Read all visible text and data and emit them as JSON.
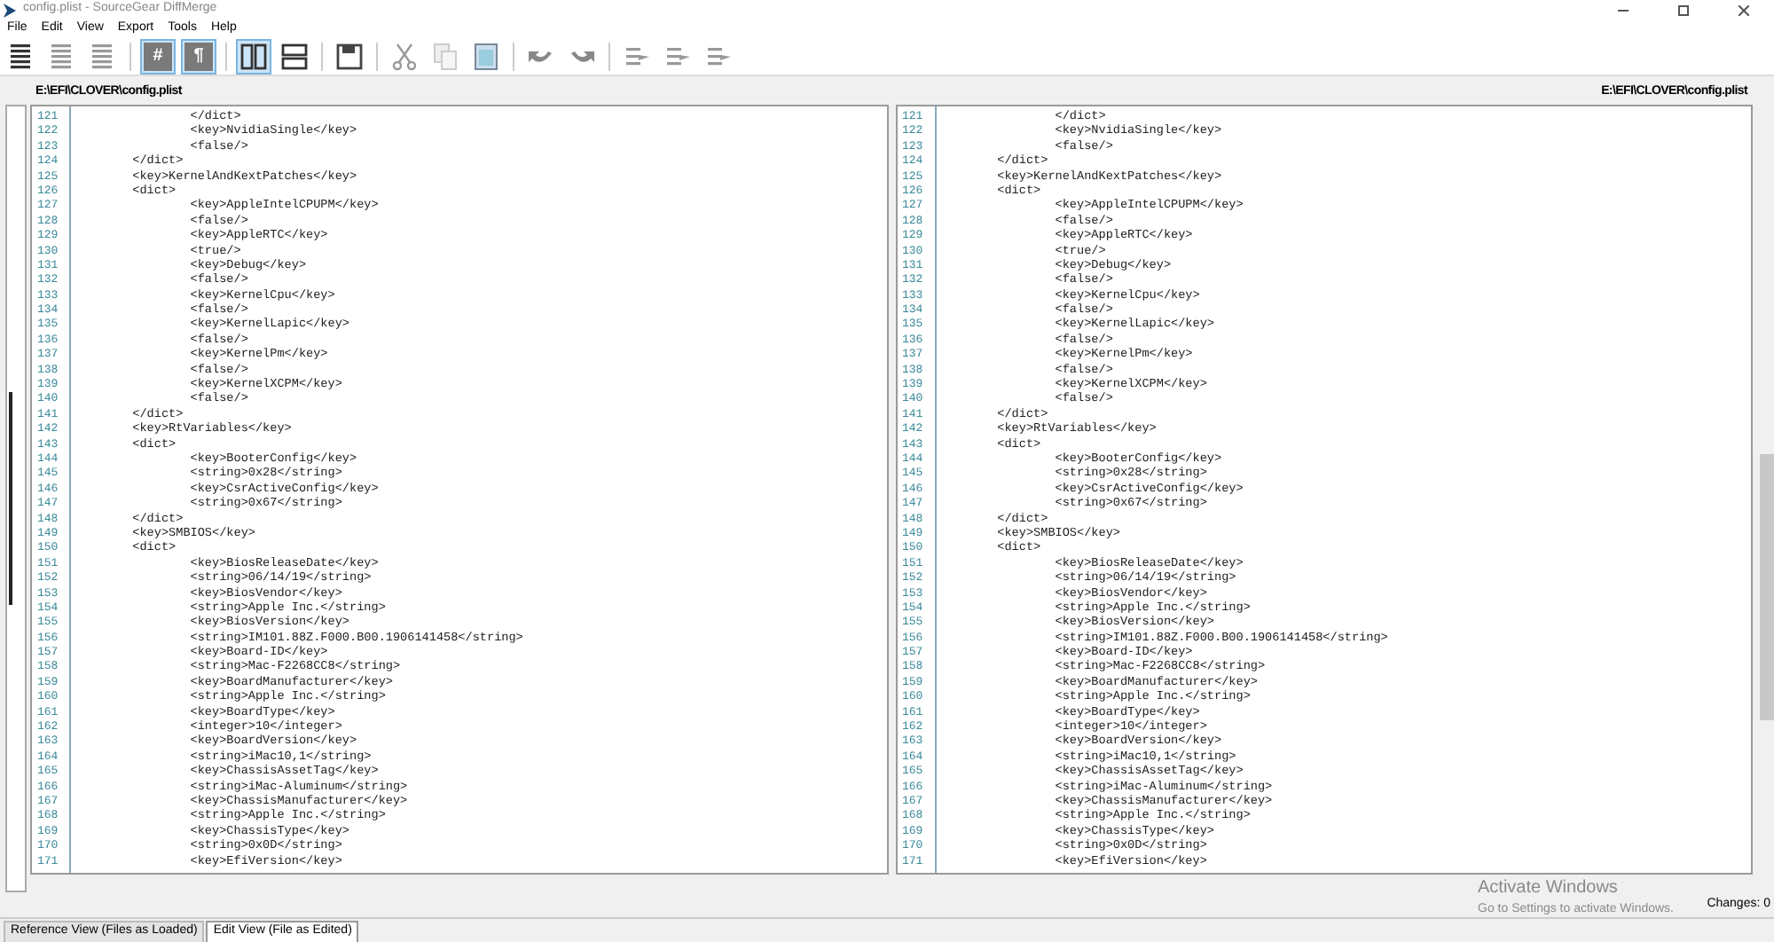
{
  "window": {
    "title": "config.plist - SourceGear DiffMerge"
  },
  "menu": [
    "File",
    "Edit",
    "View",
    "Export",
    "Tools",
    "Help"
  ],
  "toolbar": [
    {
      "kind": "lines-all",
      "selected": false
    },
    {
      "kind": "lines-diff",
      "selected": false
    },
    {
      "kind": "lines-ctx",
      "selected": false
    },
    {
      "kind": "sep"
    },
    {
      "kind": "char",
      "label": "#",
      "selected": true
    },
    {
      "kind": "char",
      "label": "¶",
      "selected": true
    },
    {
      "kind": "sep"
    },
    {
      "kind": "side-by-side",
      "selected": true
    },
    {
      "kind": "stacked",
      "selected": false
    },
    {
      "kind": "sep"
    },
    {
      "kind": "save",
      "selected": false
    },
    {
      "kind": "sep"
    },
    {
      "kind": "cut",
      "selected": false
    },
    {
      "kind": "copy",
      "selected": false
    },
    {
      "kind": "paste",
      "selected": false
    },
    {
      "kind": "sep"
    },
    {
      "kind": "undo",
      "selected": false
    },
    {
      "kind": "redo",
      "selected": false
    },
    {
      "kind": "sep"
    },
    {
      "kind": "merge-prev",
      "selected": false
    },
    {
      "kind": "merge-next",
      "selected": false
    },
    {
      "kind": "merge-all",
      "selected": false
    }
  ],
  "panes": [
    {
      "path": "E:\\EFI\\CLOVER\\config.plist",
      "lines": [
        {
          "number": "121",
          "text": "\t\t\t\t</dict>"
        },
        {
          "number": "122",
          "text": "\t\t\t\t<key>NvidiaSingle</key>"
        },
        {
          "number": "123",
          "text": "\t\t\t\t<false/>"
        },
        {
          "number": "124",
          "text": "\t\t</dict>"
        },
        {
          "number": "125",
          "text": "\t\t<key>KernelAndKextPatches</key>"
        },
        {
          "number": "126",
          "text": "\t\t<dict>"
        },
        {
          "number": "127",
          "text": "\t\t\t\t<key>AppleIntelCPUPM</key>"
        },
        {
          "number": "128",
          "text": "\t\t\t\t<false/>"
        },
        {
          "number": "129",
          "text": "\t\t\t\t<key>AppleRTC</key>"
        },
        {
          "number": "130",
          "text": "\t\t\t\t<true/>"
        },
        {
          "number": "131",
          "text": "\t\t\t\t<key>Debug</key>"
        },
        {
          "number": "132",
          "text": "\t\t\t\t<false/>"
        },
        {
          "number": "133",
          "text": "\t\t\t\t<key>KernelCpu</key>"
        },
        {
          "number": "134",
          "text": "\t\t\t\t<false/>"
        },
        {
          "number": "135",
          "text": "\t\t\t\t<key>KernelLapic</key>"
        },
        {
          "number": "136",
          "text": "\t\t\t\t<false/>"
        },
        {
          "number": "137",
          "text": "\t\t\t\t<key>KernelPm</key>"
        },
        {
          "number": "138",
          "text": "\t\t\t\t<false/>"
        },
        {
          "number": "139",
          "text": "\t\t\t\t<key>KernelXCPM</key>"
        },
        {
          "number": "140",
          "text": "\t\t\t\t<false/>"
        },
        {
          "number": "141",
          "text": "\t\t</dict>"
        },
        {
          "number": "142",
          "text": "\t\t<key>RtVariables</key>"
        },
        {
          "number": "143",
          "text": "\t\t<dict>"
        },
        {
          "number": "144",
          "text": "\t\t\t\t<key>BooterConfig</key>"
        },
        {
          "number": "145",
          "text": "\t\t\t\t<string>0x28</string>"
        },
        {
          "number": "146",
          "text": "\t\t\t\t<key>CsrActiveConfig</key>"
        },
        {
          "number": "147",
          "text": "\t\t\t\t<string>0x67</string>"
        },
        {
          "number": "148",
          "text": "\t\t</dict>"
        },
        {
          "number": "149",
          "text": "\t\t<key>SMBIOS</key>"
        },
        {
          "number": "150",
          "text": "\t\t<dict>"
        },
        {
          "number": "151",
          "text": "\t\t\t\t<key>BiosReleaseDate</key>"
        },
        {
          "number": "152",
          "text": "\t\t\t\t<string>06/14/19</string>"
        },
        {
          "number": "153",
          "text": "\t\t\t\t<key>BiosVendor</key>"
        },
        {
          "number": "154",
          "text": "\t\t\t\t<string>Apple Inc.</string>"
        },
        {
          "number": "155",
          "text": "\t\t\t\t<key>BiosVersion</key>"
        },
        {
          "number": "156",
          "text": "\t\t\t\t<string>IM101.88Z.F000.B00.1906141458</string>"
        },
        {
          "number": "157",
          "text": "\t\t\t\t<key>Board-ID</key>"
        },
        {
          "number": "158",
          "text": "\t\t\t\t<string>Mac-F2268CC8</string>"
        },
        {
          "number": "159",
          "text": "\t\t\t\t<key>BoardManufacturer</key>"
        },
        {
          "number": "160",
          "text": "\t\t\t\t<string>Apple Inc.</string>"
        },
        {
          "number": "161",
          "text": "\t\t\t\t<key>BoardType</key>"
        },
        {
          "number": "162",
          "text": "\t\t\t\t<integer>10</integer>"
        },
        {
          "number": "163",
          "text": "\t\t\t\t<key>BoardVersion</key>"
        },
        {
          "number": "164",
          "text": "\t\t\t\t<string>iMac10,1</string>"
        },
        {
          "number": "165",
          "text": "\t\t\t\t<key>ChassisAssetTag</key>"
        },
        {
          "number": "166",
          "text": "\t\t\t\t<string>iMac-Aluminum</string>"
        },
        {
          "number": "167",
          "text": "\t\t\t\t<key>ChassisManufacturer</key>"
        },
        {
          "number": "168",
          "text": "\t\t\t\t<string>Apple Inc.</string>"
        },
        {
          "number": "169",
          "text": "\t\t\t\t<key>ChassisType</key>"
        },
        {
          "number": "170",
          "text": "\t\t\t\t<string>0x0D</string>"
        },
        {
          "number": "171",
          "text": "\t\t\t\t<key>EfiVersion</key>"
        }
      ]
    },
    {
      "path": "E:\\EFI\\CLOVER\\config.plist",
      "lines": [
        {
          "number": "121",
          "text": "\t\t\t\t</dict>"
        },
        {
          "number": "122",
          "text": "\t\t\t\t<key>NvidiaSingle</key>"
        },
        {
          "number": "123",
          "text": "\t\t\t\t<false/>"
        },
        {
          "number": "124",
          "text": "\t\t</dict>"
        },
        {
          "number": "125",
          "text": "\t\t<key>KernelAndKextPatches</key>"
        },
        {
          "number": "126",
          "text": "\t\t<dict>"
        },
        {
          "number": "127",
          "text": "\t\t\t\t<key>AppleIntelCPUPM</key>"
        },
        {
          "number": "128",
          "text": "\t\t\t\t<false/>"
        },
        {
          "number": "129",
          "text": "\t\t\t\t<key>AppleRTC</key>"
        },
        {
          "number": "130",
          "text": "\t\t\t\t<true/>"
        },
        {
          "number": "131",
          "text": "\t\t\t\t<key>Debug</key>"
        },
        {
          "number": "132",
          "text": "\t\t\t\t<false/>"
        },
        {
          "number": "133",
          "text": "\t\t\t\t<key>KernelCpu</key>"
        },
        {
          "number": "134",
          "text": "\t\t\t\t<false/>"
        },
        {
          "number": "135",
          "text": "\t\t\t\t<key>KernelLapic</key>"
        },
        {
          "number": "136",
          "text": "\t\t\t\t<false/>"
        },
        {
          "number": "137",
          "text": "\t\t\t\t<key>KernelPm</key>"
        },
        {
          "number": "138",
          "text": "\t\t\t\t<false/>"
        },
        {
          "number": "139",
          "text": "\t\t\t\t<key>KernelXCPM</key>"
        },
        {
          "number": "140",
          "text": "\t\t\t\t<false/>"
        },
        {
          "number": "141",
          "text": "\t\t</dict>"
        },
        {
          "number": "142",
          "text": "\t\t<key>RtVariables</key>"
        },
        {
          "number": "143",
          "text": "\t\t<dict>"
        },
        {
          "number": "144",
          "text": "\t\t\t\t<key>BooterConfig</key>"
        },
        {
          "number": "145",
          "text": "\t\t\t\t<string>0x28</string>"
        },
        {
          "number": "146",
          "text": "\t\t\t\t<key>CsrActiveConfig</key>"
        },
        {
          "number": "147",
          "text": "\t\t\t\t<string>0x67</string>"
        },
        {
          "number": "148",
          "text": "\t\t</dict>"
        },
        {
          "number": "149",
          "text": "\t\t<key>SMBIOS</key>"
        },
        {
          "number": "150",
          "text": "\t\t<dict>"
        },
        {
          "number": "151",
          "text": "\t\t\t\t<key>BiosReleaseDate</key>"
        },
        {
          "number": "152",
          "text": "\t\t\t\t<string>06/14/19</string>"
        },
        {
          "number": "153",
          "text": "\t\t\t\t<key>BiosVendor</key>"
        },
        {
          "number": "154",
          "text": "\t\t\t\t<string>Apple Inc.</string>"
        },
        {
          "number": "155",
          "text": "\t\t\t\t<key>BiosVersion</key>"
        },
        {
          "number": "156",
          "text": "\t\t\t\t<string>IM101.88Z.F000.B00.1906141458</string>"
        },
        {
          "number": "157",
          "text": "\t\t\t\t<key>Board-ID</key>"
        },
        {
          "number": "158",
          "text": "\t\t\t\t<string>Mac-F2268CC8</string>"
        },
        {
          "number": "159",
          "text": "\t\t\t\t<key>BoardManufacturer</key>"
        },
        {
          "number": "160",
          "text": "\t\t\t\t<string>Apple Inc.</string>"
        },
        {
          "number": "161",
          "text": "\t\t\t\t<key>BoardType</key>"
        },
        {
          "number": "162",
          "text": "\t\t\t\t<integer>10</integer>"
        },
        {
          "number": "163",
          "text": "\t\t\t\t<key>BoardVersion</key>"
        },
        {
          "number": "164",
          "text": "\t\t\t\t<string>iMac10,1</string>"
        },
        {
          "number": "165",
          "text": "\t\t\t\t<key>ChassisAssetTag</key>"
        },
        {
          "number": "166",
          "text": "\t\t\t\t<string>iMac-Aluminum</string>"
        },
        {
          "number": "167",
          "text": "\t\t\t\t<key>ChassisManufacturer</key>"
        },
        {
          "number": "168",
          "text": "\t\t\t\t<string>Apple Inc.</string>"
        },
        {
          "number": "169",
          "text": "\t\t\t\t<key>ChassisType</key>"
        },
        {
          "number": "170",
          "text": "\t\t\t\t<string>0x0D</string>"
        },
        {
          "number": "171",
          "text": "\t\t\t\t<key>EfiVersion</key>"
        }
      ]
    }
  ],
  "status_bar": {
    "changes": "Changes: 0"
  },
  "os_notice": {
    "title": "Activate Windows",
    "text": "Go to Settings to activate Windows."
  },
  "bottom_tabs": [
    {
      "label": "Reference View (Files as Loaded)",
      "selected": false
    },
    {
      "label": "Edit View (File as Edited)",
      "selected": true
    }
  ]
}
